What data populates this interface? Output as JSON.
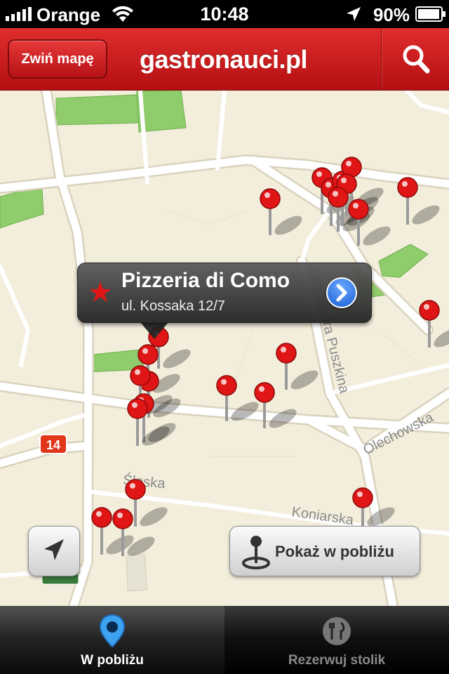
{
  "status_bar": {
    "carrier": "Orange",
    "time": "10:48",
    "battery": "90%"
  },
  "nav": {
    "collapse_label": "Zwiń mapę",
    "title": "gastronauci.pl"
  },
  "map": {
    "street_labels": {
      "puszkina": "Aleksandra Puszkina",
      "olechowska": "Olechowska",
      "slaska": "Śląska",
      "koniarska": "Koniarska",
      "route": "14"
    }
  },
  "callout": {
    "name": "Pizzeria di Como",
    "address": "ul. Kossaka 12/7"
  },
  "nearby_button": {
    "label": "Pokaż w pobliżu"
  },
  "tabs": [
    {
      "label": "W pobliżu",
      "active": true
    },
    {
      "label": "Rezerwuj stolik",
      "active": false
    }
  ],
  "colors": {
    "brand_red": "#c8181b",
    "pin_red": "#e01515"
  }
}
